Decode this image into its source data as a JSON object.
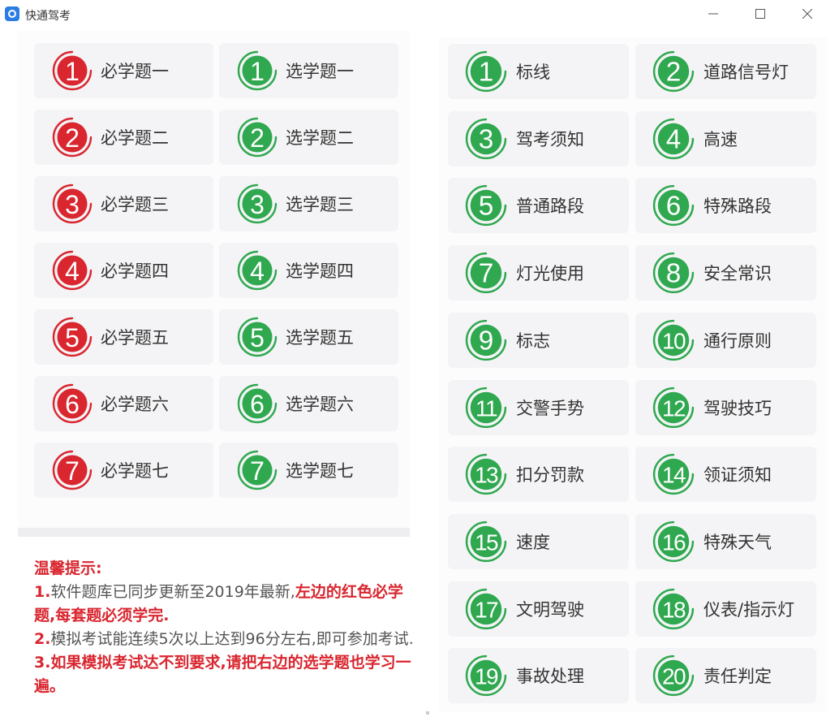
{
  "window": {
    "title": "快通驾考",
    "controls": [
      "minimize",
      "maximize",
      "close"
    ]
  },
  "colors": {
    "red": "#d9262f",
    "green": "#2fa84f",
    "tile_bg": "#f4f4f6"
  },
  "left_tiles": [
    {
      "num": "1",
      "must": "必学题一",
      "opt": "选学题一"
    },
    {
      "num": "2",
      "must": "必学题二",
      "opt": "选学题二"
    },
    {
      "num": "3",
      "must": "必学题三",
      "opt": "选学题三"
    },
    {
      "num": "4",
      "must": "必学题四",
      "opt": "选学题四"
    },
    {
      "num": "5",
      "must": "必学题五",
      "opt": "选学题五"
    },
    {
      "num": "6",
      "must": "必学题六",
      "opt": "选学题六"
    },
    {
      "num": "7",
      "must": "必学题七",
      "opt": "选学题七"
    }
  ],
  "right_tiles": [
    {
      "num": "1",
      "label": "标线"
    },
    {
      "num": "2",
      "label": "道路信号灯"
    },
    {
      "num": "3",
      "label": "驾考须知"
    },
    {
      "num": "4",
      "label": "高速"
    },
    {
      "num": "5",
      "label": "普通路段"
    },
    {
      "num": "6",
      "label": "特殊路段"
    },
    {
      "num": "7",
      "label": "灯光使用"
    },
    {
      "num": "8",
      "label": "安全常识"
    },
    {
      "num": "9",
      "label": "标志"
    },
    {
      "num": "10",
      "label": "通行原则"
    },
    {
      "num": "11",
      "label": "交警手势"
    },
    {
      "num": "12",
      "label": "驾驶技巧"
    },
    {
      "num": "13",
      "label": "扣分罚款"
    },
    {
      "num": "14",
      "label": "领证须知"
    },
    {
      "num": "15",
      "label": "速度"
    },
    {
      "num": "16",
      "label": "特殊天气"
    },
    {
      "num": "17",
      "label": "文明驾驶"
    },
    {
      "num": "18",
      "label": "仪表/指示灯"
    },
    {
      "num": "19",
      "label": "事故处理"
    },
    {
      "num": "20",
      "label": "责任判定"
    }
  ],
  "tips": {
    "title": "温馨提示:",
    "line1_num": "1.",
    "line1_text": "软件题库已同步更新至2019年最新,",
    "line1_red": "左边的红色必学题,每套题必须学完.",
    "line2_num": "2.",
    "line2_text": "模拟考试能连续5次以上达到96分左右,即可参加考试.",
    "line3": "3.如果模拟考试达不到要求,请把右边的选学题也学习一遍。"
  }
}
